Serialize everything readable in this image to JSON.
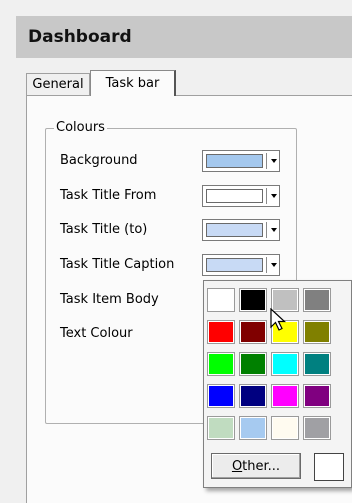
{
  "header": {
    "title": "Dashboard"
  },
  "tabs": [
    {
      "label": "General",
      "active": false
    },
    {
      "label": "Task bar",
      "active": true
    }
  ],
  "colours_group": {
    "title": "Colours",
    "rows": [
      {
        "label": "Background",
        "swatch": "#a4c8ee",
        "has_combo": true
      },
      {
        "label": "Task Title From",
        "swatch": "#ffffff",
        "has_combo": true
      },
      {
        "label": "Task Title (to)",
        "swatch": "#c8daf5",
        "has_combo": true
      },
      {
        "label": "Task Title Caption",
        "swatch": "#c8daf5",
        "has_combo": true
      },
      {
        "label": "Task Item Body",
        "has_combo": false
      },
      {
        "label": "Text Colour",
        "has_combo": false
      }
    ]
  },
  "palette": {
    "colors": [
      [
        "#ffffff",
        "#000000",
        "#c0c0c0",
        "#808080"
      ],
      [
        "#ff0000",
        "#800000",
        "#ffff00",
        "#808000"
      ],
      [
        "#00ff00",
        "#008000",
        "#00ffff",
        "#008080"
      ],
      [
        "#0000ff",
        "#000080",
        "#ff00ff",
        "#800080"
      ],
      [
        "#c0dcc0",
        "#a6caf0",
        "#fffbf0",
        "#a0a0a4"
      ]
    ],
    "other_button": {
      "accel": "O",
      "rest": "ther..."
    },
    "other_preview": "#ffffff"
  }
}
